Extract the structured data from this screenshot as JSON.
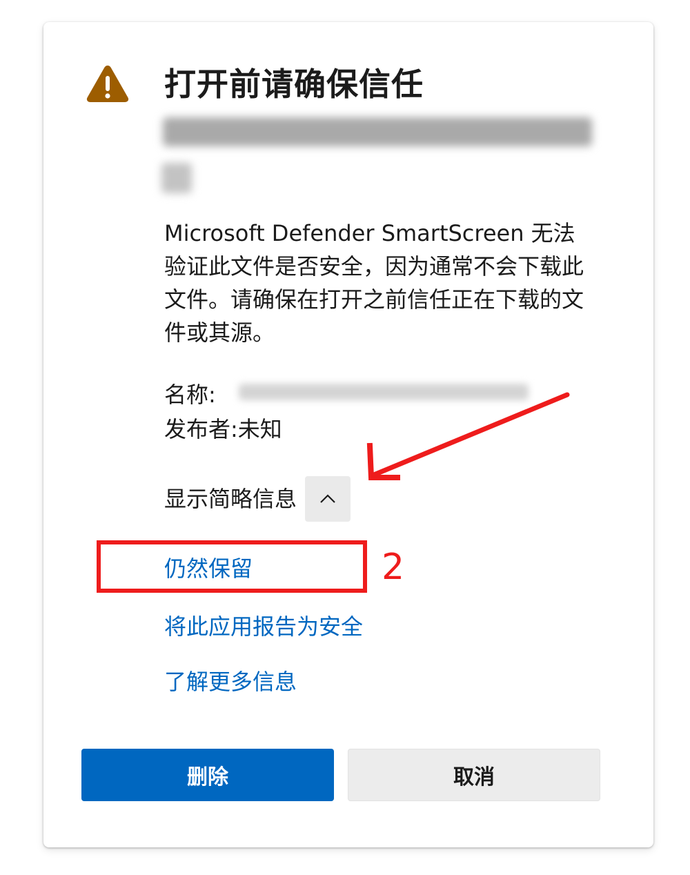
{
  "dialog": {
    "title": "打开前请确保信任",
    "description": "Microsoft Defender SmartScreen 无法验证此文件是否安全，因为通常不会下载此文件。请确保在打开之前信任正在下载的文件或其源。",
    "name_label": "名称:",
    "publisher_label": "发布者:",
    "publisher_value": "未知",
    "toggle_label": "显示简略信息",
    "links": {
      "keep": "仍然保留",
      "report": "将此应用报告为安全",
      "learn_more": "了解更多信息"
    },
    "buttons": {
      "delete": "删除",
      "cancel": "取消"
    }
  },
  "annotation": {
    "step_number": "2",
    "color": "#ee1c1c"
  },
  "icons": {
    "warning": "warning-triangle-icon",
    "chevron": "chevron-up-icon",
    "arrow": "annotation-arrow-icon"
  },
  "colors": {
    "link": "#0067c0",
    "primary_button": "#0067c0",
    "warning_icon": "#9d5d00",
    "secondary_button": "#ececec"
  }
}
